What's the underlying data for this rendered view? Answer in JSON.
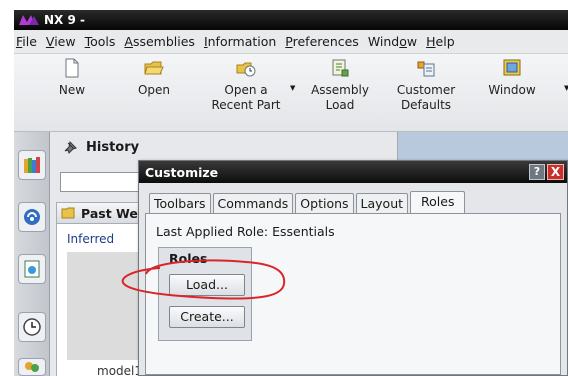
{
  "app": {
    "title": "NX 9 -"
  },
  "menu": [
    {
      "pre": "",
      "ul": "F",
      "post": "ile"
    },
    {
      "pre": "",
      "ul": "V",
      "post": "iew"
    },
    {
      "pre": "",
      "ul": "T",
      "post": "ools"
    },
    {
      "pre": "",
      "ul": "A",
      "post": "ssemblies"
    },
    {
      "pre": "",
      "ul": "I",
      "post": "nformation"
    },
    {
      "pre": "",
      "ul": "P",
      "post": "references"
    },
    {
      "pre": "Wind",
      "ul": "o",
      "post": "w"
    },
    {
      "pre": "",
      "ul": "H",
      "post": "elp"
    }
  ],
  "toolbar": {
    "new": "New",
    "open": "Open",
    "recent_line1": "Open a",
    "recent_line2": "Recent Part",
    "assembly_line1": "Assembly",
    "assembly_line2": "Load",
    "customer_line1": "Customer",
    "customer_line2": "Defaults",
    "window": "Window"
  },
  "history": {
    "title": "History",
    "section": "Past We",
    "inferred": "Inferred",
    "model": "model1"
  },
  "dialog": {
    "title": "Customize",
    "help": "?",
    "close": "X",
    "tabs": [
      "Toolbars",
      "Commands",
      "Options",
      "Layout",
      "Roles"
    ],
    "active_tab": "Roles",
    "applied_role": "Last Applied Role: Essentials",
    "roles_heading": "Roles",
    "load": "Load...",
    "create": "Create..."
  },
  "colors": {
    "titlebar": "#0c0c0c",
    "close_button": "#c8322a",
    "annotation": "#d8262a"
  }
}
